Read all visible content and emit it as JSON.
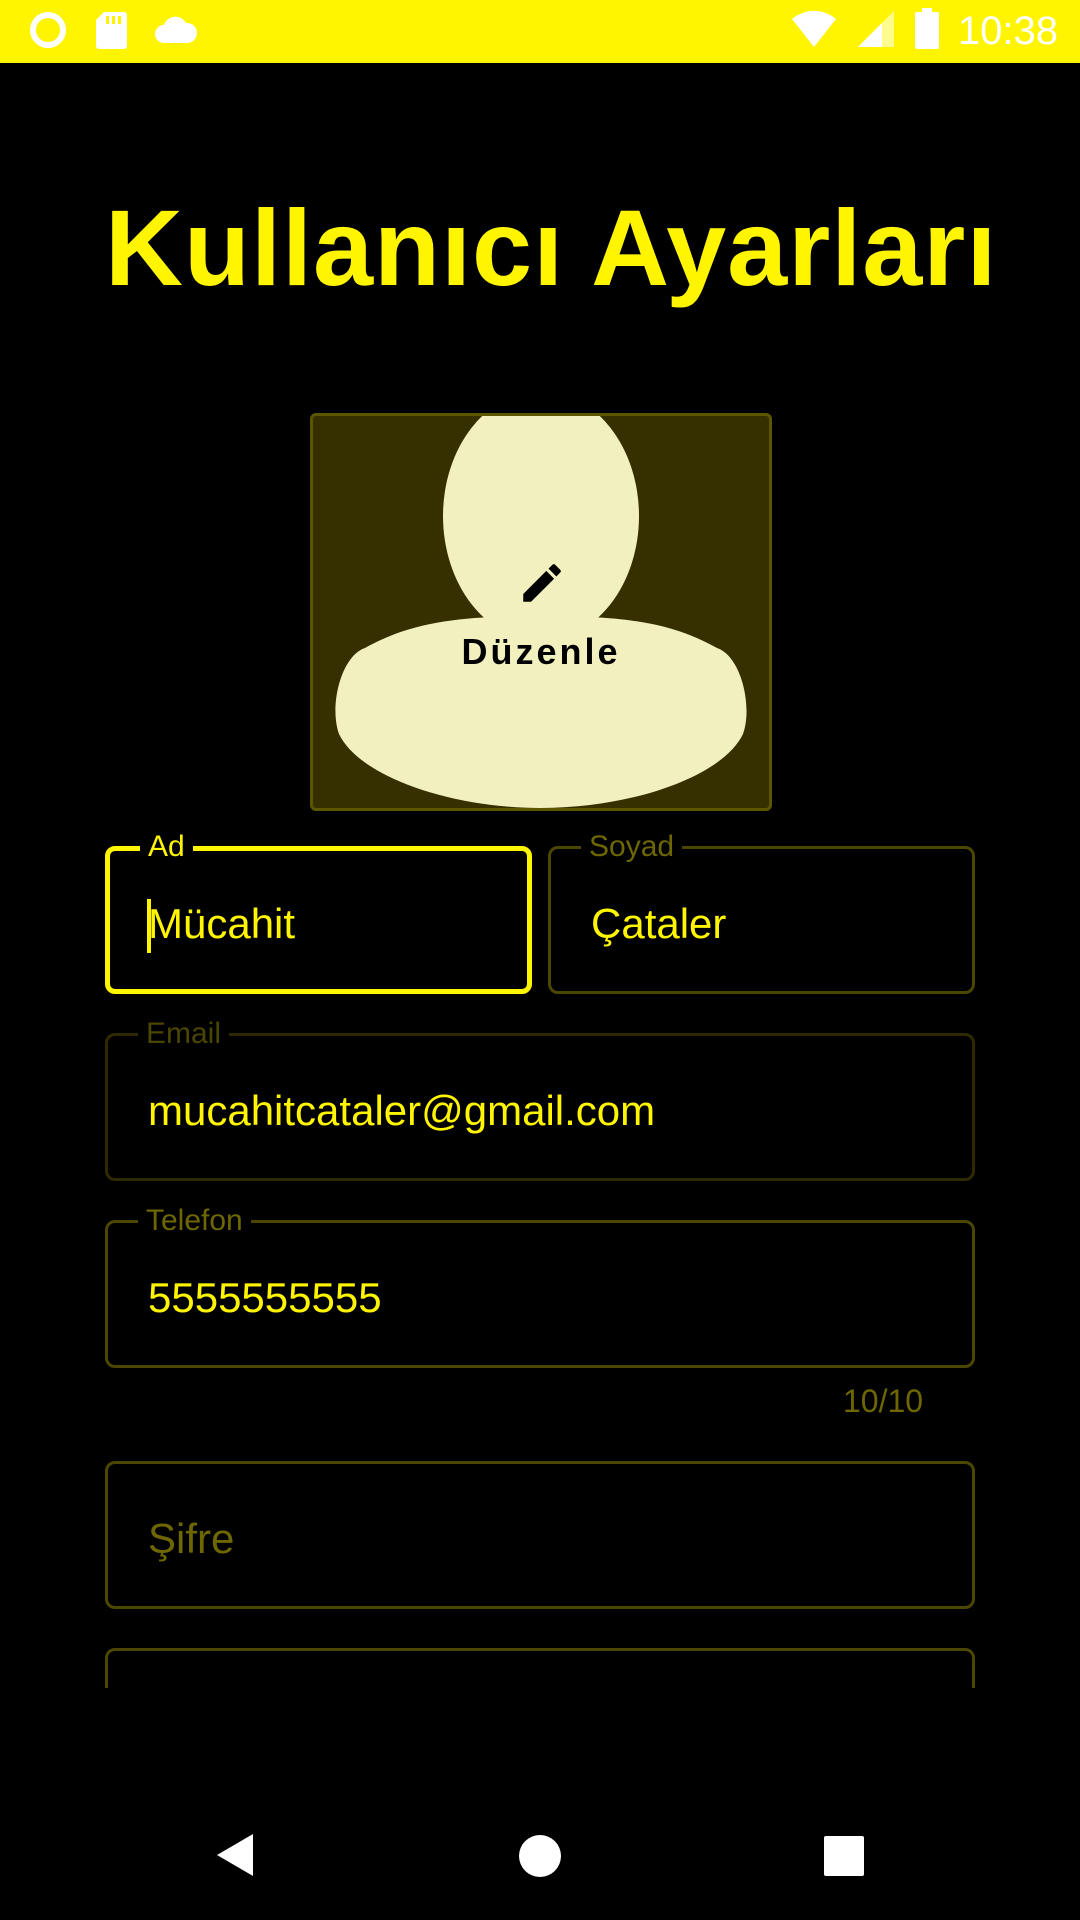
{
  "status_bar": {
    "time": "10:38",
    "left_icons": [
      "circle-icon",
      "sd-card-icon",
      "cloud-icon"
    ],
    "right_icons": [
      "wifi-icon",
      "signal-icon",
      "battery-icon"
    ]
  },
  "page": {
    "title": "Kullanıcı Ayarları"
  },
  "avatar": {
    "edit_label": "Düzenle",
    "edit_icon": "pencil-icon"
  },
  "form": {
    "first_name": {
      "label": "Ad",
      "value": "Mücahit",
      "focused": true
    },
    "last_name": {
      "label": "Soyad",
      "value": "Çataler"
    },
    "email": {
      "label": "Email",
      "value": "mucahitcataler@gmail.com",
      "enabled": false
    },
    "phone": {
      "label": "Telefon",
      "value": "5555555555",
      "counter": "10/10"
    },
    "password": {
      "placeholder": "Şifre"
    }
  },
  "nav_bar": {
    "icons": [
      "back-icon",
      "home-icon",
      "recents-icon"
    ]
  },
  "colors": {
    "accent": "#FFF500",
    "background": "#000000",
    "avatar_fill": "#F3F0C0",
    "avatar_bg": "#363000"
  }
}
